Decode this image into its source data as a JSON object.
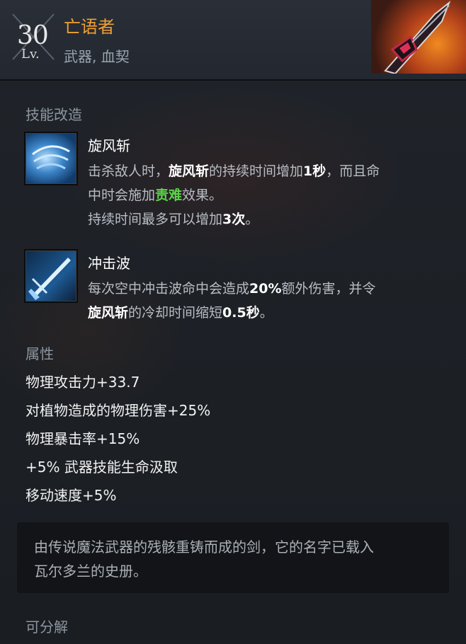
{
  "header": {
    "level_number": "30",
    "level_label": "Lv.",
    "item_name": "亡语者",
    "item_type": "武器, 血契",
    "item_icon": "cursed-sword-icon"
  },
  "skill_section": {
    "title": "技能改造",
    "skills": [
      {
        "name": "旋风斩",
        "icon": "whirlwind-icon",
        "desc_line1_a": "击杀敌人时，",
        "desc_line1_b": "旋风斩",
        "desc_line1_c": "的持续时间增加",
        "desc_line1_d": "1秒",
        "desc_line1_e": "，而且命",
        "desc_line2_a": "中时会施加",
        "desc_line2_b": "责难",
        "desc_line2_c": "效果。",
        "desc_line3_a": "持续时间最多可以增加",
        "desc_line3_b": "3次",
        "desc_line3_c": "。"
      },
      {
        "name": "冲击波",
        "icon": "sword-slash-icon",
        "desc_line1_a": "每次空中冲击波命中会造成",
        "desc_line1_b": "20%",
        "desc_line1_c": "额外伤害，并令",
        "desc_line2_a": "旋风斩",
        "desc_line2_b": "的冷却时间缩短",
        "desc_line2_c": "0.5秒",
        "desc_line2_d": "。"
      }
    ]
  },
  "attributes": {
    "title": "属性",
    "items": [
      "物理攻击力+33.7",
      "对植物造成的物理伤害+25%",
      "物理暴击率+15%",
      "+5% 武器技能生命汲取",
      "移动速度+5%"
    ]
  },
  "lore": {
    "line1": "由传说魔法武器的残骸重铸而成的剑，它的名字已载入",
    "line2": "瓦尔多兰的史册。"
  },
  "footer": {
    "label": "可分解"
  },
  "colors": {
    "item_name": "#f0a034",
    "highlight_green": "#5cd34a",
    "background": "#1b1f24"
  }
}
